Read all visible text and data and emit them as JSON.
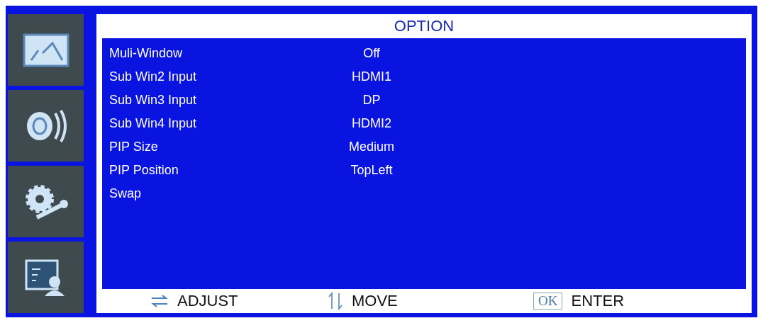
{
  "sidebar": {
    "items": [
      {
        "kind": "picture"
      },
      {
        "kind": "sound"
      },
      {
        "kind": "setup"
      },
      {
        "kind": "option"
      }
    ]
  },
  "title": "OPTION",
  "rows": [
    {
      "label": "Muli-Window",
      "value": "Off"
    },
    {
      "label": "Sub Win2 Input",
      "value": "HDMI1"
    },
    {
      "label": "Sub Win3 Input",
      "value": "DP"
    },
    {
      "label": "Sub Win4 Input",
      "value": "HDMI2"
    },
    {
      "label": "PIP Size",
      "value": "Medium"
    },
    {
      "label": "PIP Position",
      "value": "TopLeft"
    },
    {
      "label": "Swap"
    }
  ],
  "footer": [
    {
      "kind": "adjust",
      "label": "ADJUST"
    },
    {
      "kind": "move",
      "label": "MOVE"
    },
    {
      "kind": "enter",
      "key": "OK",
      "label": "ENTER"
    }
  ]
}
